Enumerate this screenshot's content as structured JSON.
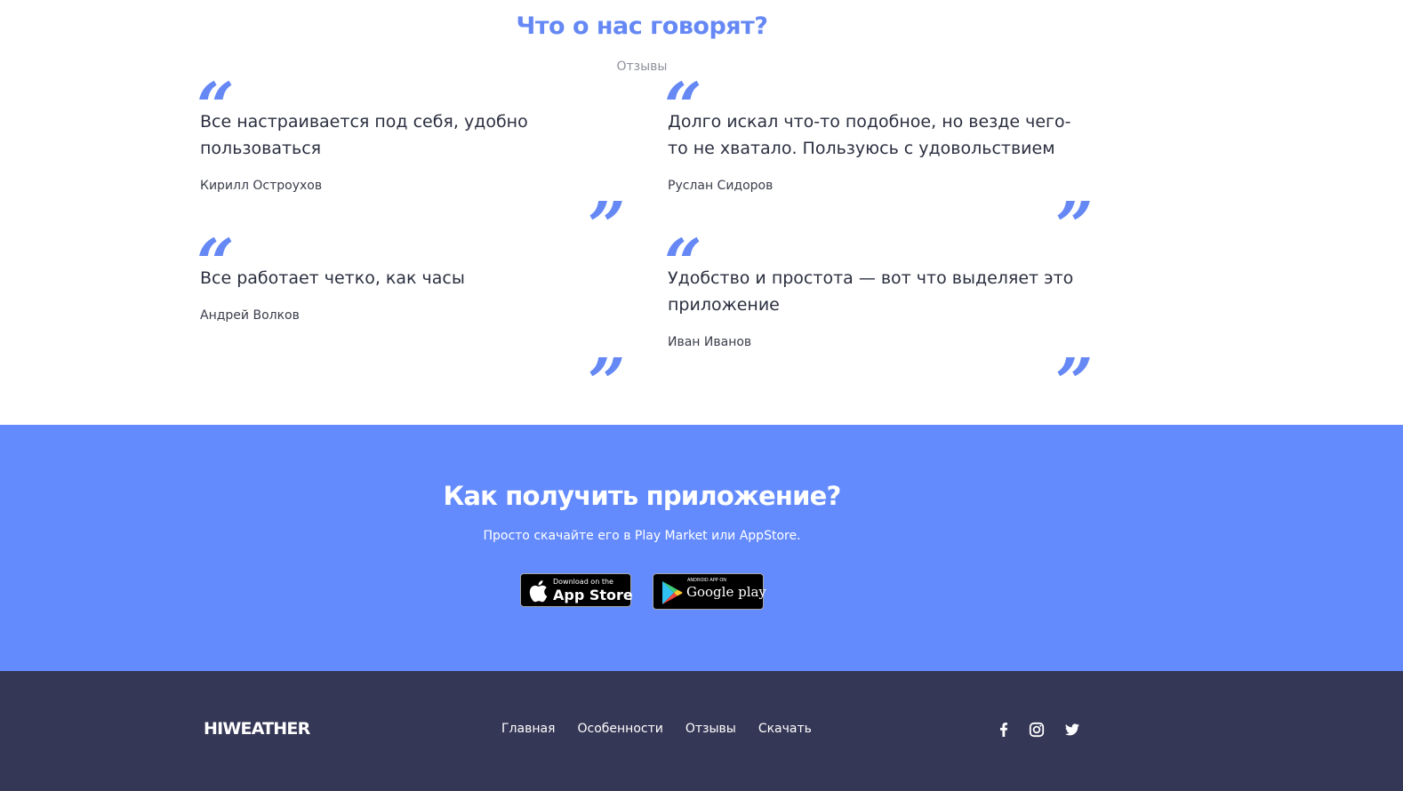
{
  "reviews": {
    "title": "Что о нас говорят?",
    "subtitle": "Отзывы",
    "items": [
      {
        "text": "Все настраивается под себя, удобно пользоваться",
        "author": "Кирилл Остроухов"
      },
      {
        "text": "Долго искал что-то подобное, но везде чего-то не хватало. Пользуюсь с удовольствием",
        "author": "Руслан Сидоров"
      },
      {
        "text": "Все работает четко, как часы",
        "author": "Андрей Волков"
      },
      {
        "text": "Удобство и простота — вот что выделяет это приложение",
        "author": "Иван Иванов"
      }
    ],
    "quote_open": "“",
    "quote_close": "”"
  },
  "get_app": {
    "title": "Как получить приложение?",
    "subtitle": "Просто скачайте его в Play Market или AppStore.",
    "app_store": {
      "small": "Download on the",
      "big": "App Store"
    },
    "google_play": {
      "small": "ANDROID APP ON",
      "big": "Google play"
    }
  },
  "footer": {
    "logo": "HIWEATHER",
    "nav": [
      "Главная",
      "Особенности",
      "Отзывы",
      "Скачать"
    ],
    "social_icons": [
      "facebook-icon",
      "instagram-icon",
      "twitter-icon"
    ]
  },
  "colors": {
    "accent": "#6588f5",
    "get_app_bg": "#648bfd",
    "footer_bg": "#353756",
    "text_dark": "#2b2f3f"
  }
}
